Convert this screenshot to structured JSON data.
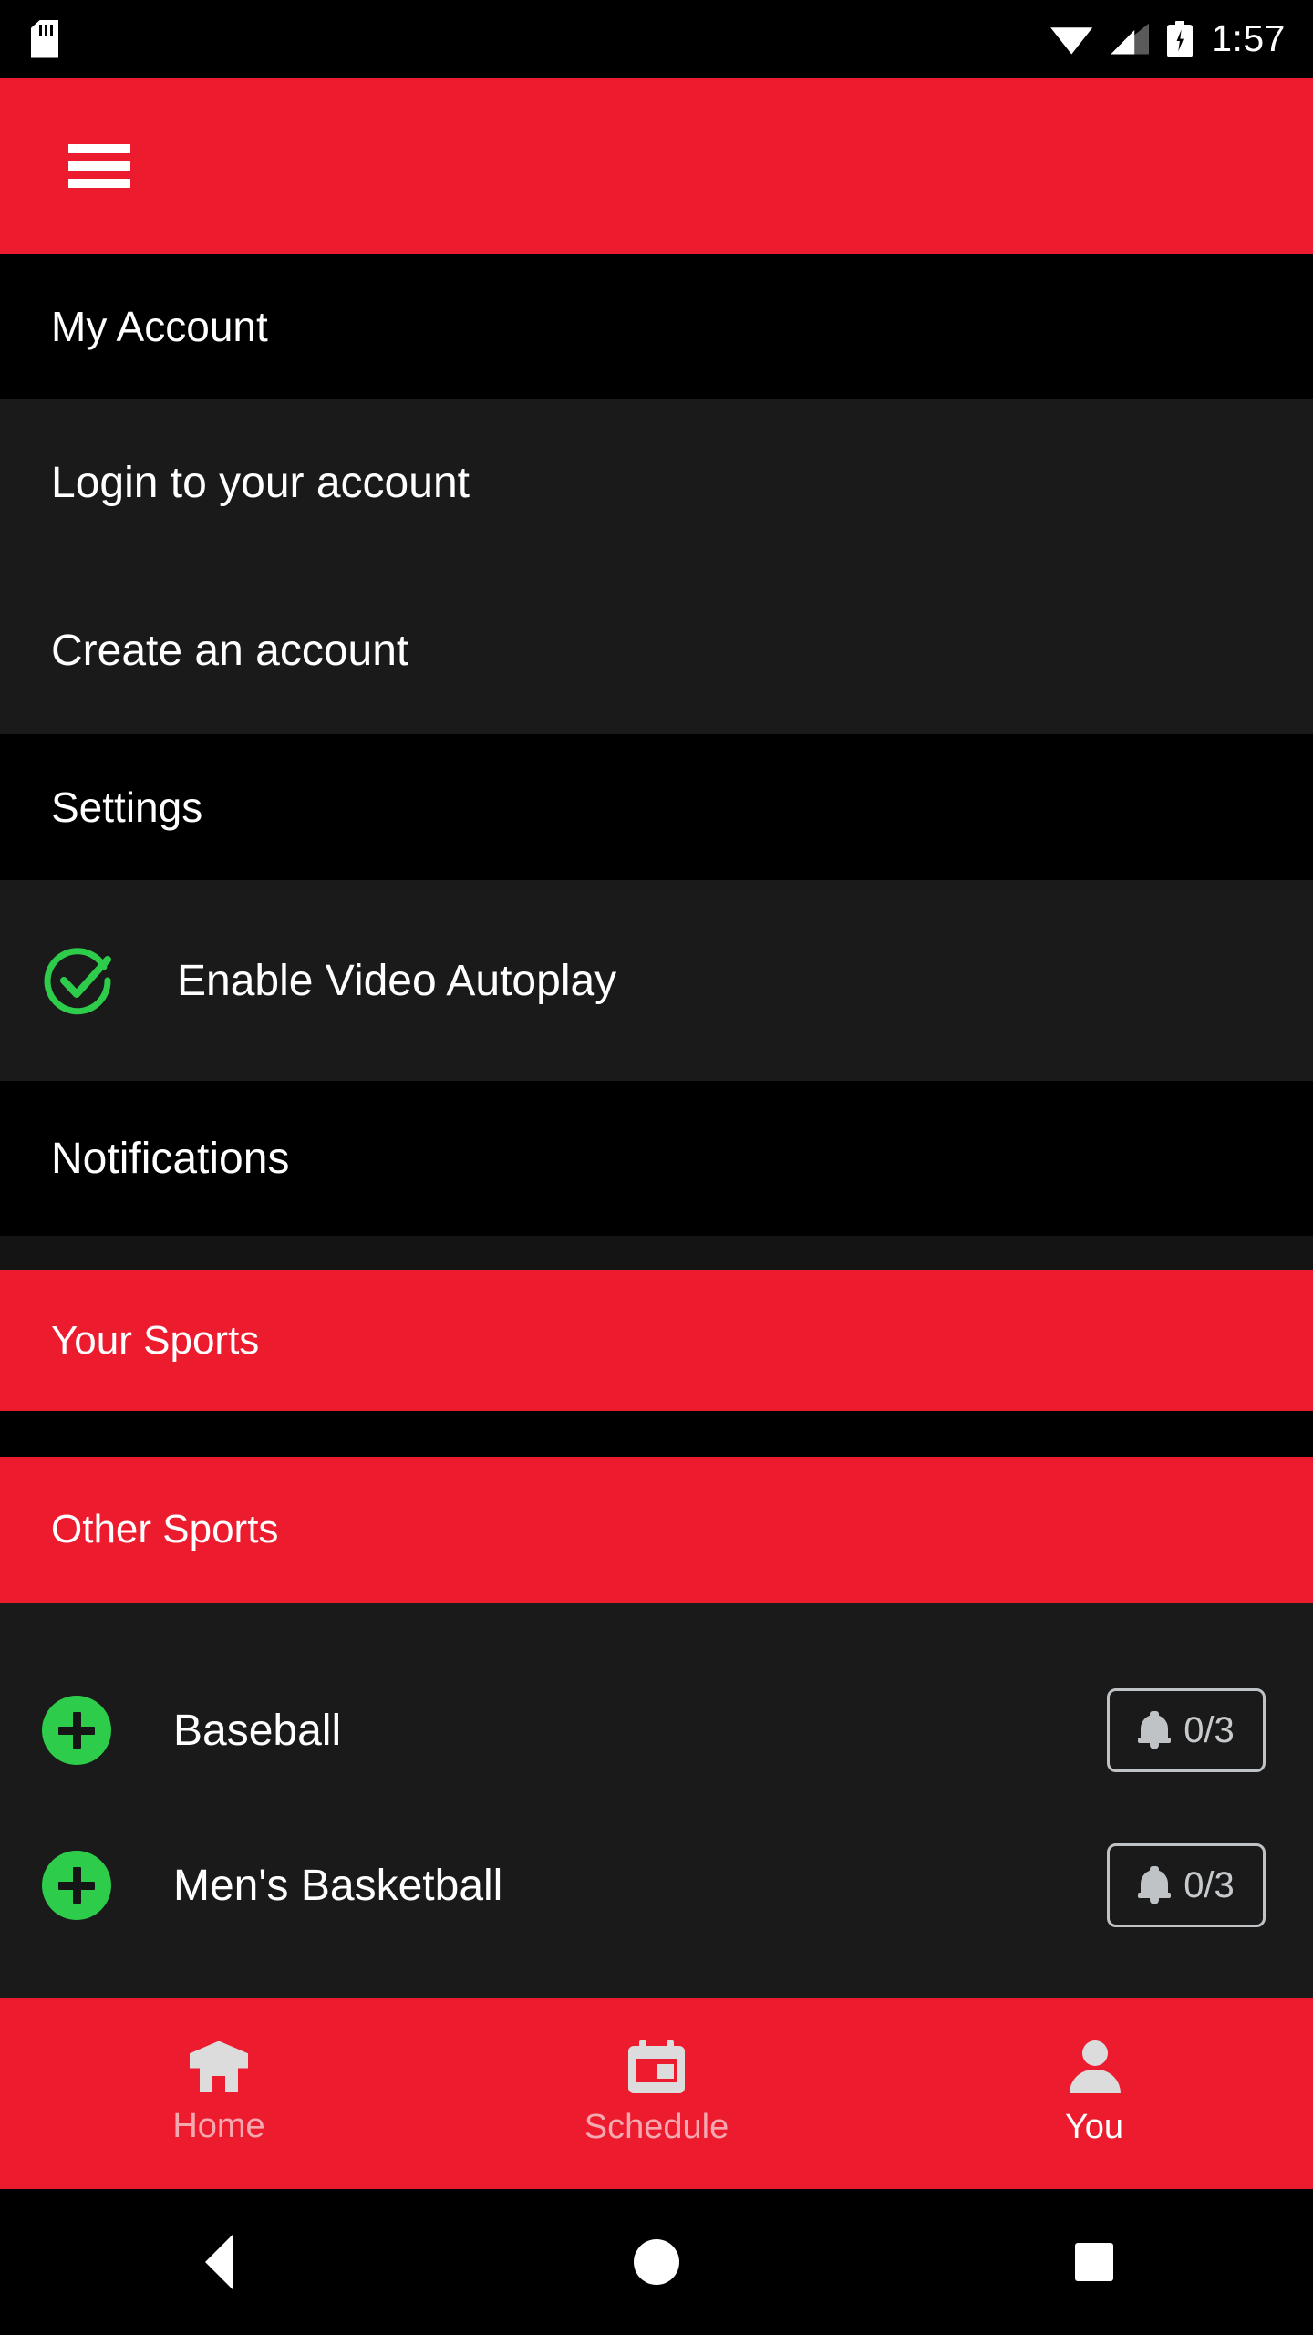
{
  "status_bar": {
    "sd_card_icon": "sd-card-icon",
    "wifi_icon": "wifi-icon",
    "cellular_icon": "cellular-signal-icon",
    "battery_icon": "battery-charging-icon",
    "time": "1:57"
  },
  "app_bar": {
    "menu_icon": "hamburger-menu-icon",
    "background_color": "#ED1B2E"
  },
  "menu": {
    "account_header": "My Account",
    "account_items": [
      {
        "label": "Login to your account"
      },
      {
        "label": "Create an account"
      }
    ],
    "settings_header": "Settings",
    "autoplay": {
      "label": "Enable Video Autoplay",
      "checked": true,
      "check_color": "#2ECC4B"
    },
    "notifications_label": "Notifications",
    "your_sports_header": "Your Sports",
    "other_sports_header": "Other Sports",
    "sports": [
      {
        "name": "Baseball",
        "add_icon": "plus-circle-icon",
        "notification_count": "0/3",
        "bell_icon": "bell-icon"
      },
      {
        "name": "Men's Basketball",
        "add_icon": "plus-circle-icon",
        "notification_count": "0/3",
        "bell_icon": "bell-icon"
      }
    ]
  },
  "bottom_nav": {
    "tabs": [
      {
        "label": "Home",
        "icon": "home-icon",
        "active": false
      },
      {
        "label": "Schedule",
        "icon": "calendar-icon",
        "active": false
      },
      {
        "label": "You",
        "icon": "person-icon",
        "active": true
      }
    ]
  },
  "android_nav": {
    "back": "back-triangle-icon",
    "home": "home-circle-icon",
    "recents": "recents-square-icon"
  }
}
